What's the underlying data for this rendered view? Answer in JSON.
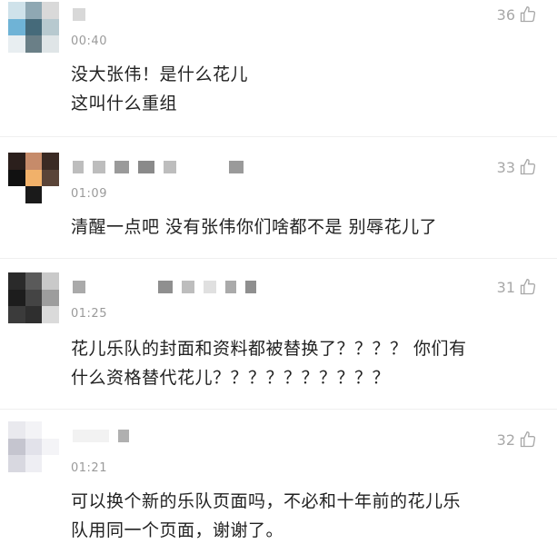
{
  "comments": [
    {
      "time": "00:40",
      "likes": "36",
      "lines": [
        "没大张伟！是什么花儿",
        "这叫什么重组"
      ]
    },
    {
      "time": "01:09",
      "likes": "33",
      "lines": [
        "清醒一点吧 没有张伟你们啥都不是 别辱花儿了"
      ]
    },
    {
      "time": "01:25",
      "likes": "31",
      "lines": [
        "花儿乐队的封面和资料都被替换了？？？？ 你们有",
        "什么资格替代花儿？？？？？？？？？？"
      ]
    },
    {
      "time": "01:21",
      "likes": "32",
      "lines": [
        "可以换个新的乐队页面吗，不必和十年前的花儿乐",
        "队用同一个页面，谢谢了。"
      ]
    }
  ],
  "icons": {
    "like": "thumbs-up-icon"
  },
  "colors": {
    "meta_gray": "#9a9a9a",
    "text": "#222222"
  }
}
